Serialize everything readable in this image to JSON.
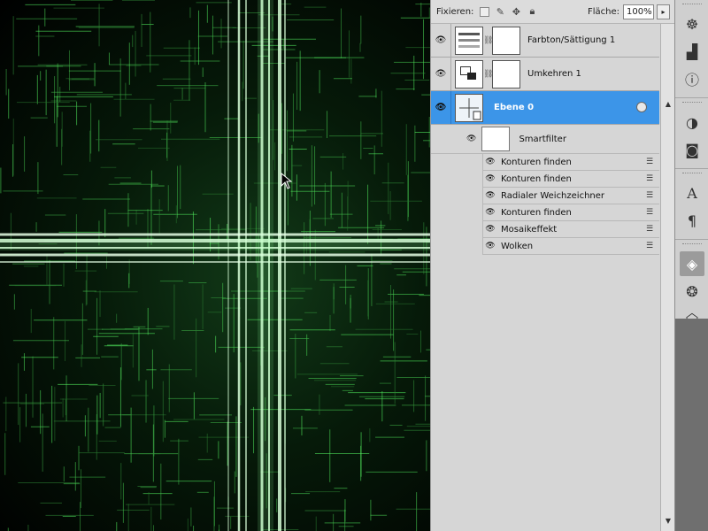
{
  "layers_panel": {
    "fixieren_label": "Fixieren:",
    "flaeche_label": "Fläche:",
    "flaeche_value": "100%",
    "layers": [
      {
        "name": "Farbton/Sättigung 1",
        "type": "adjustment-hue"
      },
      {
        "name": "Umkehren 1",
        "type": "adjustment-invert"
      },
      {
        "name": "Ebene 0",
        "type": "smart-object",
        "selected": true
      }
    ],
    "smartfilter_label": "Smartfilter",
    "filters": [
      "Konturen finden",
      "Konturen finden",
      "Radialer Weichzeichner",
      "Konturen finden",
      "Mosaikeffekt",
      "Wolken"
    ]
  },
  "icons": {
    "lock_transparency": "checkerboard-icon",
    "lock_brush": "brush-icon",
    "lock_move": "move-icon",
    "lock_all": "padlock-icon"
  },
  "dock": [
    "navigator-icon",
    "histogram-icon",
    "info-icon",
    "adjustments-icon",
    "masks-icon",
    "character-icon",
    "paragraph-icon",
    "layers-icon",
    "channels-icon",
    "paths-icon"
  ],
  "colors": {
    "selection_blue": "#3c95e8",
    "canvas_green": "#5cd46a"
  }
}
